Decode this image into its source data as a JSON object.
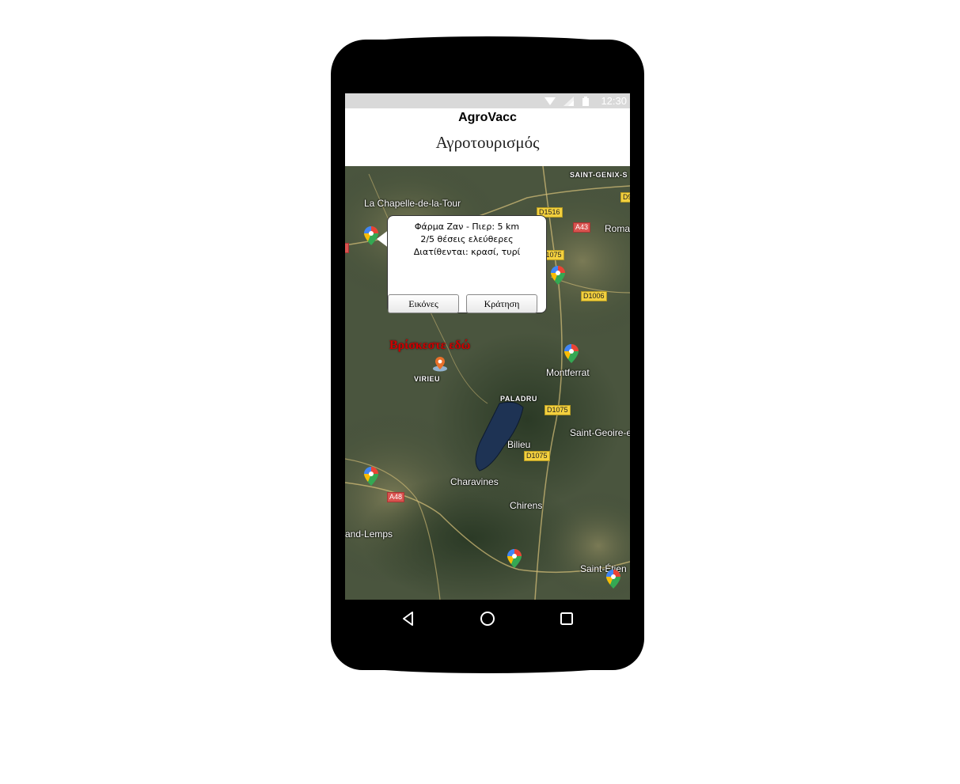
{
  "status_bar": {
    "time": "12:30"
  },
  "app": {
    "title": "AgroVacc",
    "page_title": "Αγροτουρισμός"
  },
  "popup": {
    "lines": [
      "Φάρμα Ζαν - Πιερ: 5 km",
      "2/5 θέσεις ελεύθερες",
      "Διατίθενται: κρασί, τυρί"
    ],
    "images_button": "Εικόνες",
    "booking_button": "Κράτηση"
  },
  "current_location_label": "Βρίσκεστε εδώ",
  "map_labels": {
    "saint_genix": "SAINT-GENIX-S",
    "la_chapelle": "La Chapelle-de-la-Tour",
    "roma": "Roma",
    "montferrat": "Montferrat",
    "virieu": "VIRIEU",
    "paladru": "PALADRU",
    "saint_geoire": "Saint-Geoire-e",
    "bilieu": "Bilieu",
    "charavines": "Charavines",
    "chirens": "Chirens",
    "and_lemps": "and-Lemps",
    "saint_etienne": "Saint-Étien"
  },
  "road_labels": {
    "d1516": "D1516",
    "a43": "A43",
    "d1075a": "D1075",
    "d1006": "D1006",
    "d1075b": "D1075",
    "d1075c": "D1075",
    "a48": "A48",
    "d9": "D9"
  },
  "icons": [
    "wifi-icon",
    "signal-icon",
    "battery-icon",
    "back-icon",
    "home-icon",
    "recents-icon",
    "map-pin-icon",
    "location-pin-icon"
  ]
}
